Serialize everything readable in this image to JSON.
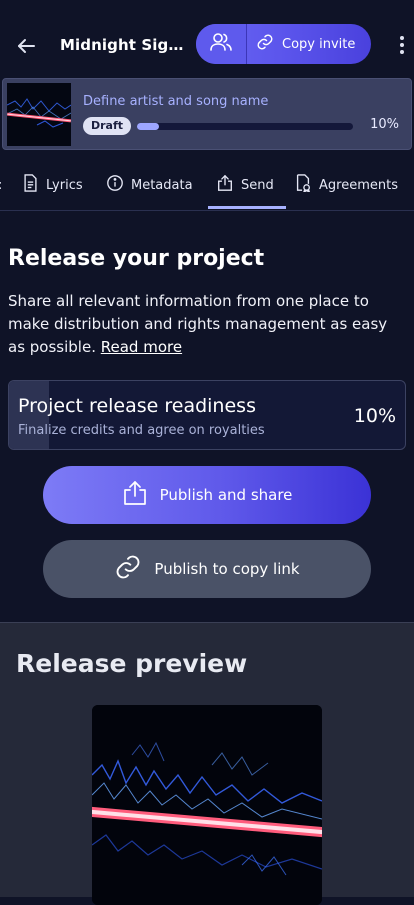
{
  "header": {
    "title": "Midnight Sign...",
    "copy_invite_label": "Copy invite"
  },
  "project": {
    "name_prompt": "Define artist and song name",
    "status_badge": "Draft",
    "progress_percent": 10,
    "progress_label": "10%"
  },
  "tabs": [
    {
      "label": "Lyrics",
      "icon": "document-icon"
    },
    {
      "label": "Metadata",
      "icon": "info-icon"
    },
    {
      "label": "Send",
      "icon": "share-icon",
      "active": true
    },
    {
      "label": "Agreements",
      "icon": "contract-icon"
    }
  ],
  "main": {
    "heading": "Release your project",
    "description": "Share all relevant information from one place to make distribution and rights management as easy as possible.",
    "read_more": "Read more",
    "readiness": {
      "title": "Project release readiness",
      "subtitle": "Finalize credits and agree on royalties",
      "percent": 10,
      "percent_label": "10%"
    },
    "publish_button": "Publish and share",
    "copy_link_button": "Publish to copy link"
  },
  "preview": {
    "heading": "Release preview"
  },
  "colors": {
    "background": "#0f1327",
    "accent": "#5b55ec",
    "accent_light": "#a7b1ff",
    "card": "#3a4061"
  }
}
